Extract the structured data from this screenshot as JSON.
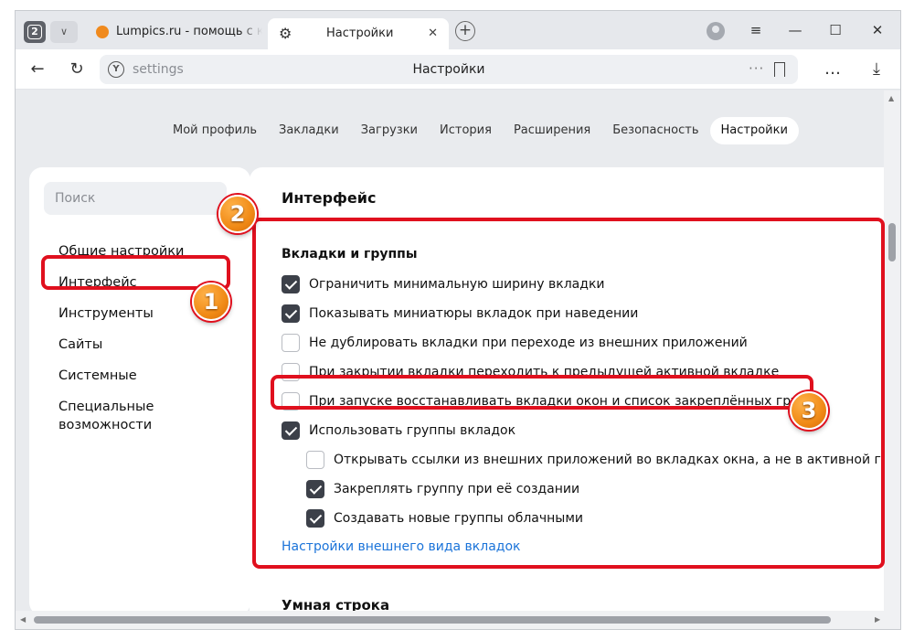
{
  "browser": {
    "tab_count": "2",
    "tabs": [
      {
        "title": "Lumpics.ru - помощь с компьютером"
      },
      {
        "title": "Настройки"
      }
    ],
    "address": {
      "url": "settings",
      "page_title": "Настройки"
    }
  },
  "topnav": {
    "items": [
      "Мой профиль",
      "Закладки",
      "Загрузки",
      "История",
      "Расширения",
      "Безопасность",
      "Настройки"
    ],
    "active": "Настройки"
  },
  "sidebar": {
    "search_placeholder": "Поиск",
    "items": [
      "Общие настройки",
      "Интерфейс",
      "Инструменты",
      "Сайты",
      "Системные",
      "Специальные возможности"
    ]
  },
  "main": {
    "section_title": "Интерфейс",
    "group_title": "Вкладки и группы",
    "options": [
      {
        "label": "Ограничить минимальную ширину вкладки",
        "checked": true
      },
      {
        "label": "Показывать миниатюры вкладок при наведении",
        "checked": true
      },
      {
        "label": "Не дублировать вкладки при переходе из внешних приложений",
        "checked": false
      },
      {
        "label": "При закрытии вкладки переходить к предыдущей активной вкладке",
        "checked": false
      },
      {
        "label": "При запуске восстанавливать вкладки окон и список закреплённых групп",
        "checked": false
      },
      {
        "label": "Использовать группы вкладок",
        "checked": true
      },
      {
        "label": "Открывать ссылки из внешних приложений во вкладках окна, а не в активной группе",
        "checked": false
      },
      {
        "label": "Закреплять группу при её создании",
        "checked": true
      },
      {
        "label": "Создавать новые группы облачными",
        "checked": true
      }
    ],
    "link": "Настройки внешнего вида вкладок",
    "next_section": "Умная строка"
  },
  "annotations": {
    "badge1": "1",
    "badge2": "2",
    "badge3": "3",
    "color": "#e0101e"
  }
}
